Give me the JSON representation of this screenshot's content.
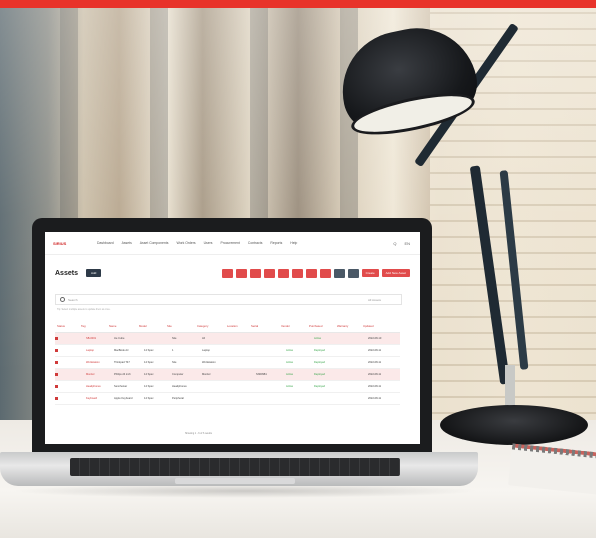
{
  "scene": {
    "accent_bar_color": "#e8332a"
  },
  "app": {
    "logo": "SIRIUS",
    "nav": [
      "Dashboard",
      "Assets",
      "Asset Components",
      "Work Orders",
      "Users",
      "Procurement",
      "Contracts",
      "Reports",
      "Help"
    ],
    "nav_right": [
      "Q",
      "EN"
    ],
    "page_title": "Assets",
    "head_button": "Add",
    "toolbar_primary": "Create",
    "toolbar_secondary": "Add New Asset",
    "search_placeholder": "Search",
    "search_filter": "All Assets",
    "hint": "Tip: Select multiple assets to update them at once.",
    "columns": [
      "Status",
      "Tag",
      "Name",
      "Model",
      "Site",
      "Category",
      "Location",
      "Serial",
      "Vendor",
      "Purchased",
      "Warranty",
      "Updated"
    ],
    "rows": [
      {
        "c": [
          "",
          "SB-0001",
          "Ice Cube",
          "",
          "Site",
          "All",
          "",
          "",
          "",
          "Active",
          "",
          "2022-08-10"
        ],
        "pink": true
      },
      {
        "c": [
          "",
          "Laptop",
          "MacBook Air",
          "14 Spec",
          "1",
          "Laptop",
          "",
          "",
          "Active",
          "Deployed",
          "",
          "2022-08-11"
        ],
        "pink": false
      },
      {
        "c": [
          "",
          "Workstation",
          "Thinkpad T47",
          "14 Spec",
          "Site",
          "Workstation",
          "",
          "",
          "Active",
          "Deployed",
          "",
          "2022-08-11"
        ],
        "pink": false
      },
      {
        "c": [
          "",
          "Monitor",
          "Philips 24 inch",
          "14 Spec",
          "Computer",
          "Monitor",
          "",
          "SN00981",
          "Active",
          "Deployed",
          "",
          "2022-08-11"
        ],
        "pink": true
      },
      {
        "c": [
          "",
          "Headphones",
          "Sennheiser",
          "14 Spec",
          "Headphones",
          "",
          "",
          "",
          "Active",
          "Deployed",
          "",
          "2022-08-11"
        ],
        "pink": false
      },
      {
        "c": [
          "",
          "Keyboard",
          "Apple Keyboard",
          "14 Spec",
          "Peripheral",
          "",
          "",
          "",
          "",
          "",
          "",
          "2022-08-11"
        ],
        "pink": false
      }
    ],
    "pager": "Showing 1 - 6 of 6 results"
  }
}
